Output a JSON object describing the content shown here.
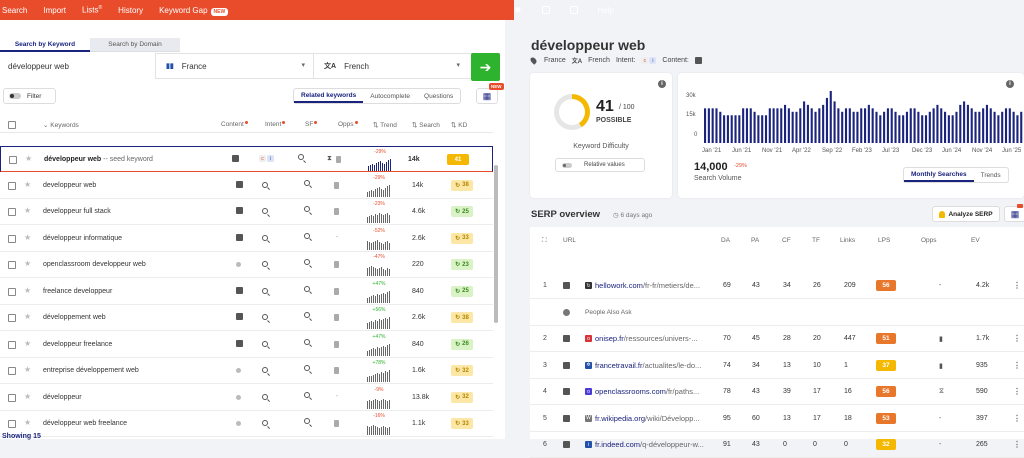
{
  "topnav": {
    "items": [
      "Search",
      "Import",
      "Lists",
      "History",
      "Keyword Gap"
    ],
    "new_badge": "NEW",
    "help": "Help"
  },
  "tabs": {
    "by_keyword": "Search by Keyword",
    "by_domain": "Search by Domain"
  },
  "search": {
    "value": "développeur web",
    "country": "France",
    "country_flag": "▮▮",
    "language": "French",
    "language_flag": "文A"
  },
  "filter": {
    "label": "Filter"
  },
  "segments": [
    "Related keywords",
    "Autocomplete",
    "Questions"
  ],
  "table_btn_badge": "NEW",
  "columns": {
    "keywords": "Keywords",
    "content": "Content",
    "intent": "Intent",
    "sf": "SF",
    "opps": "Opps",
    "trend": "Trend",
    "search": "Search",
    "kd": "KD"
  },
  "rows": [
    {
      "keyword": "développeur web",
      "seed_label": "-- seed keyword",
      "trend_pct": "-29%",
      "trend_color": "#e84c2b",
      "search": "14k",
      "kd": "41",
      "kd_color": "#f5b800",
      "bars": [
        5,
        6,
        7,
        6,
        8,
        9,
        10,
        8,
        7,
        9,
        11,
        12
      ],
      "opps": "hour"
    },
    {
      "keyword": "developpeur web",
      "trend_pct": "-29%",
      "trend_color": "#e84c2b",
      "search": "14k",
      "kd": "38",
      "kd_color": "#fde7a6",
      "kd_text": "#b38600",
      "bars": [
        5,
        6,
        7,
        6,
        8,
        9,
        10,
        8,
        7,
        9,
        11,
        12
      ],
      "opps": "doc"
    },
    {
      "keyword": "developpeur full stack",
      "trend_pct": "-23%",
      "trend_color": "#e84c2b",
      "search": "4.6k",
      "kd": "25",
      "kd_color": "#d9f2c6",
      "kd_text": "#3a8a1f",
      "bars": [
        6,
        7,
        8,
        7,
        9,
        8,
        10,
        9,
        8,
        9,
        10,
        8
      ],
      "opps": "doc"
    },
    {
      "keyword": "développeur informatique",
      "trend_pct": "-52%",
      "trend_color": "#e84c2b",
      "search": "2.6k",
      "kd": "33",
      "kd_color": "#fde7a6",
      "kd_text": "#b38600",
      "bars": [
        9,
        8,
        7,
        8,
        9,
        10,
        8,
        7,
        6,
        8,
        9,
        7
      ],
      "opps": "dash"
    },
    {
      "keyword": "openclassroom developpeur web",
      "trend_pct": "-47%",
      "trend_color": "#e84c2b",
      "search": "220",
      "kd": "23",
      "kd_color": "#d9f2c6",
      "kd_text": "#3a8a1f",
      "bars": [
        8,
        9,
        10,
        9,
        8,
        7,
        8,
        9,
        7,
        6,
        8,
        7
      ],
      "opps": "doc"
    },
    {
      "keyword": "freelance developpeur",
      "trend_pct": "+47%",
      "trend_color": "#2eb32e",
      "search": "840",
      "kd": "25",
      "kd_color": "#d9f2c6",
      "kd_text": "#3a8a1f",
      "bars": [
        5,
        6,
        7,
        8,
        7,
        9,
        8,
        9,
        10,
        9,
        11,
        12
      ],
      "opps": "doc"
    },
    {
      "keyword": "développement web",
      "trend_pct": "+56%",
      "trend_color": "#2eb32e",
      "search": "2.6k",
      "kd": "38",
      "kd_color": "#fde7a6",
      "kd_text": "#b38600",
      "bars": [
        6,
        7,
        8,
        7,
        9,
        8,
        10,
        9,
        10,
        11,
        10,
        12
      ],
      "opps": "doc"
    },
    {
      "keyword": "developpeur freelance",
      "trend_pct": "+47%",
      "trend_color": "#2eb32e",
      "search": "840",
      "kd": "26",
      "kd_color": "#d9f2c6",
      "kd_text": "#3a8a1f",
      "bars": [
        5,
        6,
        7,
        8,
        7,
        9,
        8,
        9,
        10,
        9,
        11,
        12
      ],
      "opps": "doc"
    },
    {
      "keyword": "entreprise développement web",
      "trend_pct": "+78%",
      "trend_color": "#2eb32e",
      "search": "1.6k",
      "kd": "32",
      "kd_color": "#fde7a6",
      "kd_text": "#b38600",
      "bars": [
        5,
        6,
        6,
        7,
        8,
        9,
        8,
        10,
        9,
        11,
        10,
        12
      ],
      "opps": "doc"
    },
    {
      "keyword": "développeur",
      "trend_pct": "-9%",
      "trend_color": "#e84c2b",
      "search": "13.8k",
      "kd": "32",
      "kd_color": "#fde7a6",
      "kd_text": "#b38600",
      "bars": [
        8,
        9,
        8,
        9,
        10,
        9,
        8,
        9,
        10,
        9,
        8,
        9
      ],
      "opps": "dash"
    },
    {
      "keyword": "développeur web freelance",
      "trend_pct": "-16%",
      "trend_color": "#e84c2b",
      "search": "1.1k",
      "kd": "33",
      "kd_color": "#fde7a6",
      "kd_text": "#b38600",
      "bars": [
        9,
        8,
        9,
        10,
        9,
        8,
        7,
        8,
        9,
        8,
        7,
        8
      ],
      "opps": "doc"
    }
  ],
  "showing": "Showing 15",
  "detail": {
    "title": "développeur web",
    "country": "France",
    "language": "French",
    "intent_label": "Intent:",
    "content_label": "Content:"
  },
  "kd_card": {
    "value": "41",
    "of": "/ 100",
    "label": "POSSIBLE",
    "title": "Keyword Difficulty",
    "relative": "Relative values",
    "percent": 41
  },
  "volume_card": {
    "value": "14,000",
    "pct": "-29%",
    "label": "Search Volume",
    "tabs": [
      "Monthly Searches",
      "Trends"
    ]
  },
  "chart_data": {
    "type": "bar",
    "title": "",
    "ylabel": "",
    "xlabel": "",
    "ylim": [
      0,
      30000
    ],
    "yticks": [
      "30k",
      "15k",
      "0"
    ],
    "x_tick_labels": [
      "Jan '21",
      "Jun '21",
      "Nov '21",
      "Apr '22",
      "Sep '22",
      "Feb '23",
      "Jul '23",
      "Dec '23",
      "Jun '24",
      "Nov '24",
      "Jun '25"
    ],
    "values": [
      20000,
      20000,
      20000,
      20000,
      18000,
      16000,
      16000,
      16000,
      16000,
      16000,
      20000,
      20000,
      20000,
      18000,
      16000,
      16000,
      16000,
      20000,
      20000,
      20000,
      20000,
      22000,
      20000,
      18000,
      18000,
      20000,
      24000,
      22000,
      20000,
      18000,
      20000,
      22000,
      26000,
      30000,
      24000,
      20000,
      18000,
      20000,
      20000,
      18000,
      18000,
      20000,
      20000,
      22000,
      20000,
      18000,
      16000,
      18000,
      20000,
      20000,
      18000,
      16000,
      16000,
      18000,
      20000,
      20000,
      18000,
      16000,
      16000,
      18000,
      20000,
      22000,
      20000,
      18000,
      16000,
      16000,
      18000,
      22000,
      24000,
      22000,
      20000,
      18000,
      18000,
      20000,
      22000,
      20000,
      18000,
      16000,
      18000,
      20000,
      20000,
      18000,
      16000,
      18000
    ],
    "color": "#1a237e"
  },
  "serp": {
    "title": "SERP overview",
    "ago": "6 days ago",
    "analyze": "Analyze SERP",
    "columns": {
      "url": "URL",
      "da": "DA",
      "pa": "PA",
      "cf": "CF",
      "tf": "TF",
      "links": "Links",
      "lps": "LPS",
      "opps": "Opps",
      "ev": "EV"
    },
    "paa": "People Also Ask",
    "rows": [
      {
        "n": "1",
        "domain": "hellowork.com",
        "path": "/fr-fr/metiers/de...",
        "da": "69",
        "pa": "43",
        "cf": "34",
        "tf": "26",
        "links": "209",
        "lps": "56",
        "lps_color": "#e8772b",
        "opps": "-",
        "ev": "4.2k",
        "fav": "↻",
        "fav_color": "#333"
      },
      {
        "n": "2",
        "domain": "onisep.fr",
        "path": "/ressources/univers-...",
        "da": "70",
        "pa": "45",
        "cf": "28",
        "tf": "20",
        "links": "447",
        "lps": "51",
        "lps_color": "#e8772b",
        "opps": "▮",
        "ev": "1.7k",
        "fav": "o",
        "fav_color": "#d6333a"
      },
      {
        "n": "3",
        "domain": "francetravail.fr",
        "path": "/actualites/le-do...",
        "da": "74",
        "pa": "34",
        "cf": "13",
        "tf": "10",
        "links": "1",
        "lps": "37",
        "lps_color": "#f5b800",
        "opps": "▮",
        "ev": "935",
        "fav": "✲",
        "fav_color": "#2350a8"
      },
      {
        "n": "4",
        "domain": "openclassrooms.com",
        "path": "/fr/paths...",
        "da": "78",
        "pa": "43",
        "cf": "39",
        "tf": "17",
        "links": "16",
        "lps": "56",
        "lps_color": "#e8772b",
        "opps": "⧖",
        "ev": "590",
        "fav": "o",
        "fav_color": "#4d3bd6"
      },
      {
        "n": "5",
        "domain": "fr.wikipedia.org",
        "path": "/wiki/Développ...",
        "da": "95",
        "pa": "60",
        "cf": "13",
        "tf": "17",
        "links": "18",
        "lps": "53",
        "lps_color": "#e8772b",
        "opps": "-",
        "ev": "397",
        "fav": "W",
        "fav_color": "#777"
      },
      {
        "n": "6",
        "domain": "fr.indeed.com",
        "path": "/q-développeur-w...",
        "da": "91",
        "pa": "43",
        "cf": "0",
        "tf": "0",
        "links": "0",
        "lps": "32",
        "lps_color": "#f5b800",
        "opps": "-",
        "ev": "265",
        "fav": "i",
        "fav_color": "#2350a8"
      }
    ]
  }
}
